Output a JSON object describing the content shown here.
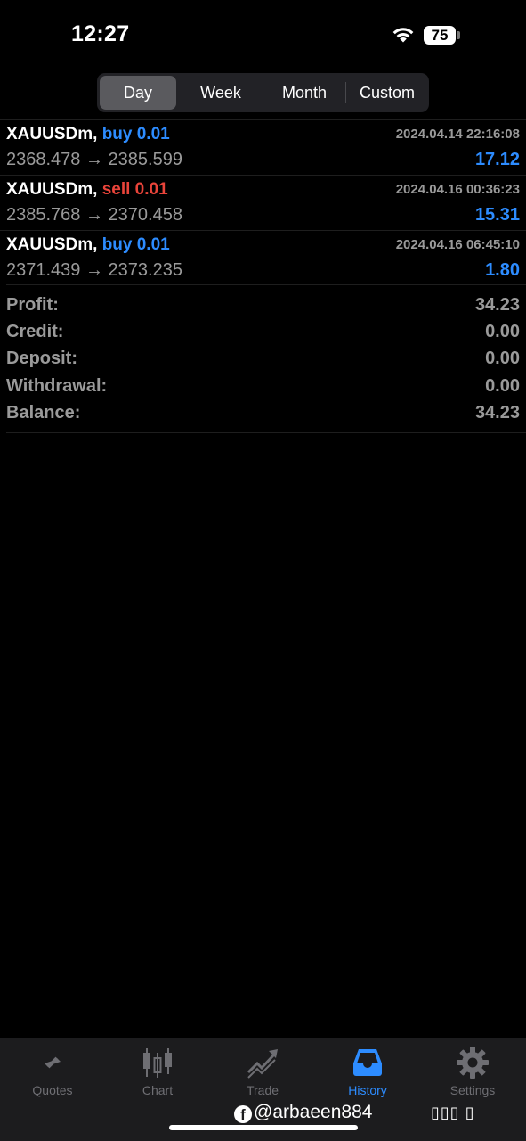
{
  "status_bar": {
    "time": "12:27",
    "battery": "75"
  },
  "period_tabs": [
    {
      "label": "Day",
      "active": true
    },
    {
      "label": "Week",
      "active": false
    },
    {
      "label": "Month",
      "active": false
    },
    {
      "label": "Custom",
      "active": false
    }
  ],
  "deals": [
    {
      "symbol": "XAUUSDm,",
      "type": "buy 0.01",
      "side": "buy",
      "time": "2024.04.14 22:16:08",
      "prices": "2368.478 → 2385.599",
      "profit": "17.12"
    },
    {
      "symbol": "XAUUSDm,",
      "type": "sell 0.01",
      "side": "sell",
      "time": "2024.04.16 00:36:23",
      "prices": "2385.768 → 2370.458",
      "profit": "15.31"
    },
    {
      "symbol": "XAUUSDm,",
      "type": "buy 0.01",
      "side": "buy",
      "time": "2024.04.16 06:45:10",
      "prices": "2371.439 → 2373.235",
      "profit": "1.80"
    }
  ],
  "summary": [
    {
      "label": "Profit:",
      "value": "34.23"
    },
    {
      "label": "Credit:",
      "value": "0.00"
    },
    {
      "label": "Deposit:",
      "value": "0.00"
    },
    {
      "label": "Withdrawal:",
      "value": "0.00"
    },
    {
      "label": "Balance:",
      "value": "34.23"
    }
  ],
  "tabbar": [
    {
      "label": "Quotes",
      "icon": "quotes-icon",
      "active": false
    },
    {
      "label": "Chart",
      "icon": "chart-icon",
      "active": false
    },
    {
      "label": "Trade",
      "icon": "trade-icon",
      "active": false
    },
    {
      "label": "History",
      "icon": "history-icon",
      "active": true
    },
    {
      "label": "Settings",
      "icon": "settings-icon",
      "active": false
    }
  ],
  "watermark": {
    "handle": "@arbaeen884",
    "trailing": "▯▯▯  ▯"
  },
  "colors": {
    "accent": "#2d8cff",
    "sell": "#e9443a",
    "muted": "#9a9a9a",
    "background": "#000000",
    "tabbar": "#1c1c1e"
  }
}
